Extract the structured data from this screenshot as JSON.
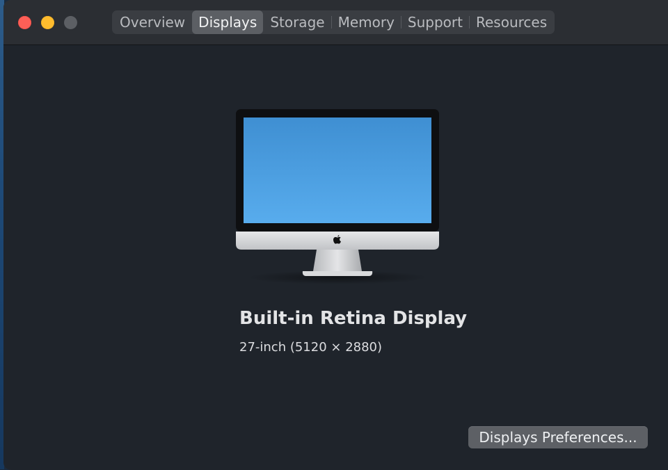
{
  "window": {
    "traffic_lights": {
      "close_color": "#fe5f57",
      "minimize_color": "#febc2e",
      "zoom_color": "#5c5f64"
    }
  },
  "tabs": [
    {
      "label": "Overview",
      "active": false
    },
    {
      "label": "Displays",
      "active": true
    },
    {
      "label": "Storage",
      "active": false
    },
    {
      "label": "Memory",
      "active": false
    },
    {
      "label": "Support",
      "active": false
    },
    {
      "label": "Resources",
      "active": false
    }
  ],
  "display": {
    "icon": "imac-icon",
    "logo": "apple-logo-icon",
    "name": "Built-in Retina Display",
    "spec": "27-inch (5120 × 2880)",
    "screen_color": "#4a9fe0"
  },
  "footer": {
    "preferences_button_label": "Displays Preferences..."
  }
}
